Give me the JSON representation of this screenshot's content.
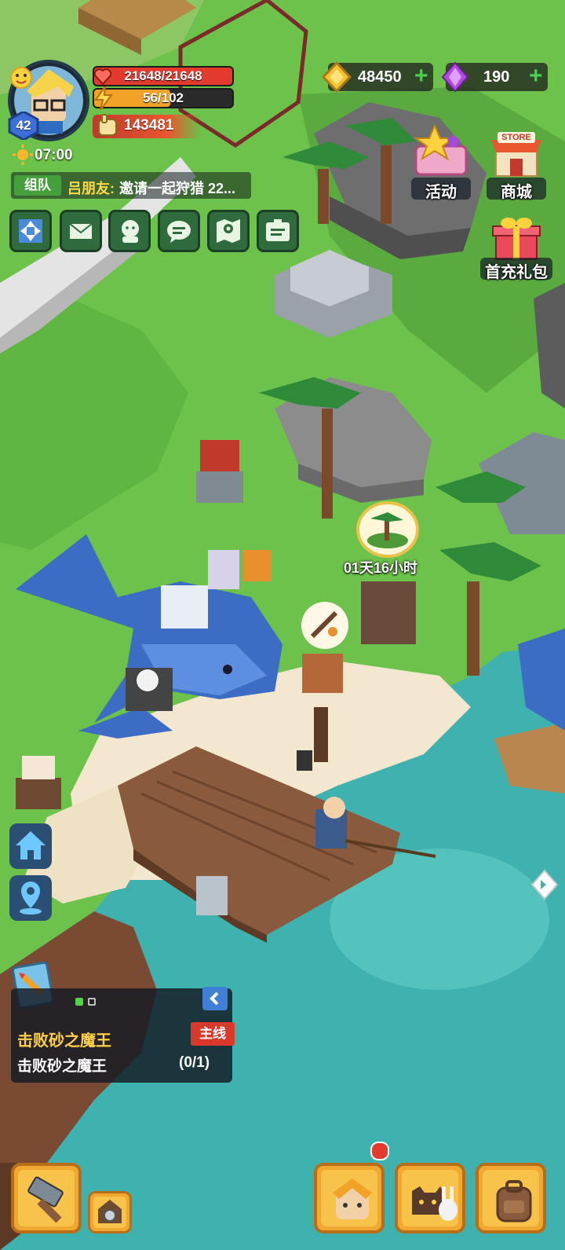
{
  "player": {
    "level": "42",
    "hp": "21648/21648",
    "hp_fraction": 1.0,
    "energy": "56/102",
    "energy_fraction": 0.549,
    "power": "143481",
    "time": "07:00"
  },
  "chat": {
    "tag": "组队",
    "name": "吕朋友:",
    "message": "邀请一起狩猎 22..."
  },
  "currency": {
    "gold": "48450",
    "gems": "190"
  },
  "side_buttons": {
    "activity": "活动",
    "store_sign": "STORE",
    "shop": "商城",
    "first_charge": "首充礼包"
  },
  "map": {
    "island_timer": "01天16小时"
  },
  "quest": {
    "title": "击败砂之魔王",
    "tag": "主线",
    "description": "击败砂之魔王",
    "progress": "(0/1)",
    "page_dots": 2,
    "active_page": 1
  },
  "icons": {
    "menu": [
      "fullscreen-icon",
      "mail-icon",
      "friends-icon",
      "chat-icon",
      "map-icon",
      "id-card-icon"
    ],
    "bottom": [
      "hammer-icon",
      "settings-gear-icon",
      "hero-portrait-icon",
      "pets-icon",
      "backpack-icon"
    ]
  },
  "colors": {
    "hp": "#e23b2e",
    "energy": "#f2a227",
    "gold": "#f2c230",
    "gem": "#b04be0",
    "quest_tag": "#d8392b",
    "chat_tag": "#43a03a"
  }
}
